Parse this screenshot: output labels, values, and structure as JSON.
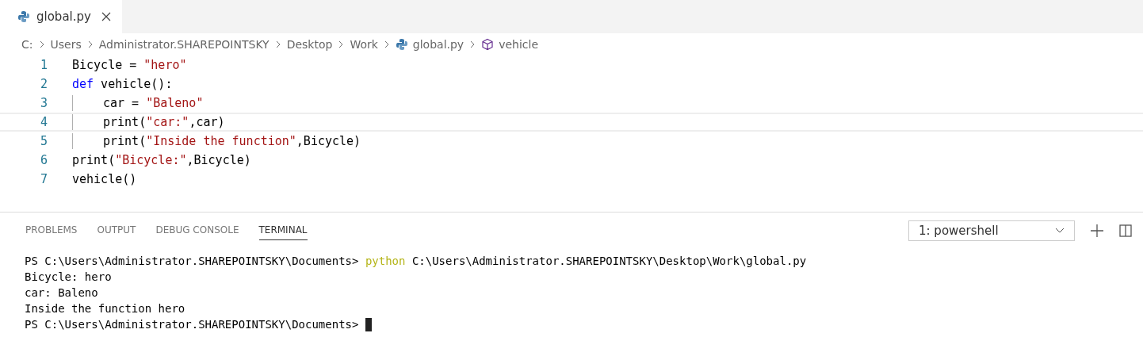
{
  "tabs": [
    {
      "label": "global.py",
      "selected": true
    }
  ],
  "breadcrumbs": [
    {
      "label": "C:",
      "kind": "folder"
    },
    {
      "label": "Users",
      "kind": "folder"
    },
    {
      "label": "Administrator.SHAREPOINTSKY",
      "kind": "folder"
    },
    {
      "label": "Desktop",
      "kind": "folder"
    },
    {
      "label": "Work",
      "kind": "folder"
    },
    {
      "label": "global.py",
      "kind": "file"
    },
    {
      "label": "vehicle",
      "kind": "symbol"
    }
  ],
  "code_lines": [
    {
      "number": "1",
      "indented": false,
      "current": false,
      "tokens": [
        {
          "kind": "plain",
          "text": "Bicycle = "
        },
        {
          "kind": "string",
          "text": "\"hero\""
        }
      ]
    },
    {
      "number": "2",
      "indented": false,
      "current": false,
      "tokens": [
        {
          "kind": "keyword",
          "text": "def"
        },
        {
          "kind": "plain",
          "text": " vehicle():"
        }
      ]
    },
    {
      "number": "3",
      "indented": true,
      "current": false,
      "tokens": [
        {
          "kind": "plain",
          "text": "car = "
        },
        {
          "kind": "string",
          "text": "\"Baleno\""
        }
      ]
    },
    {
      "number": "4",
      "indented": true,
      "current": true,
      "tokens": [
        {
          "kind": "plain",
          "text": "print("
        },
        {
          "kind": "string",
          "text": "\"car:\""
        },
        {
          "kind": "plain",
          "text": ",car)"
        }
      ]
    },
    {
      "number": "5",
      "indented": true,
      "current": false,
      "tokens": [
        {
          "kind": "plain",
          "text": "print("
        },
        {
          "kind": "string",
          "text": "\"Inside the function\""
        },
        {
          "kind": "plain",
          "text": ",Bicycle)"
        }
      ]
    },
    {
      "number": "6",
      "indented": false,
      "current": false,
      "tokens": [
        {
          "kind": "plain",
          "text": "print("
        },
        {
          "kind": "string",
          "text": "\"Bicycle:\""
        },
        {
          "kind": "plain",
          "text": ",Bicycle)"
        }
      ]
    },
    {
      "number": "7",
      "indented": false,
      "current": false,
      "tokens": [
        {
          "kind": "plain",
          "text": "vehicle()"
        }
      ]
    }
  ],
  "panel_tabs": [
    {
      "label": "PROBLEMS",
      "selected": false
    },
    {
      "label": "OUTPUT",
      "selected": false
    },
    {
      "label": "DEBUG CONSOLE",
      "selected": false
    },
    {
      "label": "TERMINAL",
      "selected": true
    }
  ],
  "terminal_select": {
    "value": "1: powershell"
  },
  "terminal_lines": [
    {
      "tokens": [
        {
          "kind": "plain",
          "text": "PS C:\\Users\\Administrator.SHAREPOINTSKY\\Documents> "
        },
        {
          "kind": "command",
          "text": "python"
        },
        {
          "kind": "plain",
          "text": " C:\\Users\\Administrator.SHAREPOINTSKY\\Desktop\\Work\\global.py"
        }
      ],
      "cursor": false
    },
    {
      "tokens": [
        {
          "kind": "plain",
          "text": "Bicycle: hero"
        }
      ],
      "cursor": false
    },
    {
      "tokens": [
        {
          "kind": "plain",
          "text": "car: Baleno"
        }
      ],
      "cursor": false
    },
    {
      "tokens": [
        {
          "kind": "plain",
          "text": "Inside the function hero"
        }
      ],
      "cursor": false
    },
    {
      "tokens": [
        {
          "kind": "plain",
          "text": "PS C:\\Users\\Administrator.SHAREPOINTSKY\\Documents> "
        }
      ],
      "cursor": true
    }
  ]
}
